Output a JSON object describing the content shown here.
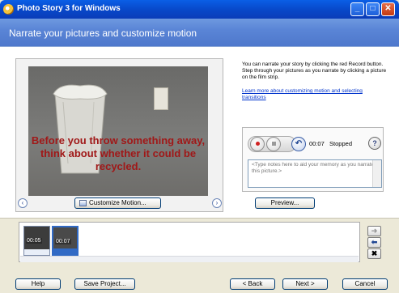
{
  "window": {
    "title": "Photo Story 3 for Windows",
    "controls": {
      "minimize": "_",
      "maximize": "□",
      "close": "✕"
    }
  },
  "page": {
    "heading": "Narrate your pictures and customize motion"
  },
  "picture": {
    "caption": "Before you throw something away, think about whether it could be recycled."
  },
  "instructions": {
    "text": "You can narrate your story by clicking the red Record button. Step through your pictures as you narrate by clicking a picture on the film strip.",
    "link": "Learn more about customizing motion and selecting transitions"
  },
  "narration": {
    "time": "00:07",
    "status": "Stopped",
    "notes_placeholder": "<Type notes here to aid your memory as you narrate this picture.>"
  },
  "buttons": {
    "customize_motion": "Customize Motion...",
    "preview": "Preview...",
    "help": "Help",
    "save_project": "Save Project...",
    "back": "< Back",
    "next": "Next >",
    "cancel": "Cancel"
  },
  "filmstrip": {
    "thumbnails": [
      {
        "time": "00:05",
        "selected": false
      },
      {
        "time": "00:07",
        "selected": true
      }
    ]
  },
  "icons": {
    "nav_left": "‹",
    "nav_right": "›",
    "undo": "↶",
    "help": "?",
    "move_right": "➜",
    "move_left": "⬅",
    "delete": "✖"
  },
  "colors": {
    "titlebar": "#0A5FE6",
    "header": "#5A85D6",
    "caption_text": "#A01818",
    "link": "#0033CC",
    "record_red": "#D02222"
  }
}
